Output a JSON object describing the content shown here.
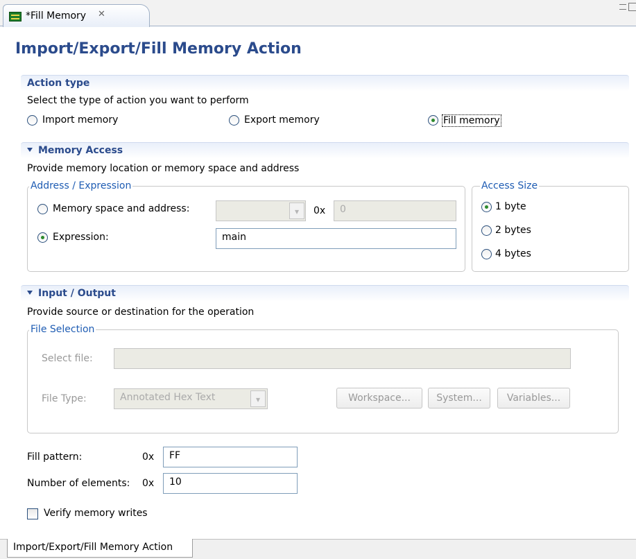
{
  "editor_tab": {
    "title": "*Fill Memory",
    "close_glyph": "✕",
    "icon": "memory-chip-icon"
  },
  "page_title": "Import/Export/Fill Memory Action",
  "action_type": {
    "title": "Action type",
    "description": "Select the type of action you want to perform",
    "options": [
      "Import memory",
      "Export memory",
      "Fill memory"
    ],
    "selected": "Fill memory"
  },
  "memory_access": {
    "title": "Memory Access",
    "description": "Provide memory location or memory space and address",
    "address_group": {
      "legend": "Address / Expression",
      "space_label": "Memory space and address:",
      "space_value": "",
      "hex_prefix": "0x",
      "address_value": "0",
      "expression_label": "Expression:",
      "expression_value": "main",
      "selected": "Expression"
    },
    "access_size": {
      "legend": "Access Size",
      "options": [
        "1 byte",
        "2 bytes",
        "4 bytes"
      ],
      "selected": "1 byte"
    }
  },
  "input_output": {
    "title": "Input / Output",
    "description": "Provide source or destination for the operation",
    "file_selection": {
      "legend": "File Selection",
      "select_file_label": "Select file:",
      "select_file_value": "",
      "file_type_label": "File Type:",
      "file_type_value": "Annotated Hex Text",
      "buttons": [
        "Workspace...",
        "System...",
        "Variables..."
      ]
    }
  },
  "fill": {
    "pattern_label": "Fill pattern:",
    "pattern_prefix": "0x",
    "pattern_value": "FF",
    "count_label": "Number of elements:",
    "count_prefix": "0x",
    "count_value": "10",
    "verify_label": "Verify memory writes",
    "verify_checked": false
  },
  "bottom_tab": "Import/Export/Fill Memory Action",
  "colors": {
    "heading": "#2b4b8c",
    "legend": "#1e5cb3",
    "radio_dot": "#2d8a2d"
  }
}
